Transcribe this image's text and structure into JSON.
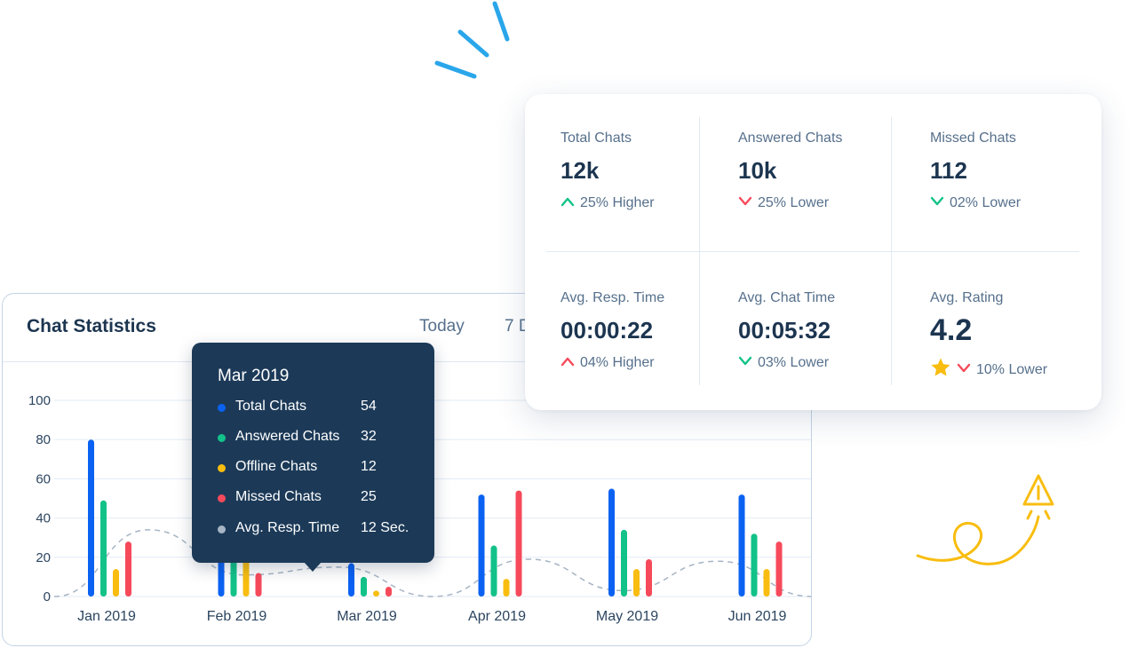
{
  "chart_panel": {
    "title": "Chat Statistics",
    "ranges": [
      "Today",
      "7 D"
    ]
  },
  "chart_data": {
    "type": "bar",
    "categories": [
      "Jan 2019",
      "Feb 2019",
      "Mar 2019",
      "Apr 2019",
      "May 2019",
      "Jun 2019"
    ],
    "series": [
      {
        "name": "Total Chats",
        "color": "#0b62f2",
        "values": [
          80,
          57,
          17,
          52,
          55,
          52
        ]
      },
      {
        "name": "Answered Chats",
        "color": "#12c289",
        "values": [
          49,
          30,
          10,
          26,
          34,
          32
        ]
      },
      {
        "name": "Offline Chats",
        "color": "#f8bd10",
        "values": [
          14,
          24,
          3,
          9,
          14,
          14
        ]
      },
      {
        "name": "Missed Chats",
        "color": "#f64a5b",
        "values": [
          28,
          12,
          5,
          54,
          19,
          28
        ]
      }
    ],
    "trend_line": {
      "name": "Avg. Resp. Time",
      "color": "#a6b4c4",
      "values": [
        0,
        34,
        11,
        15,
        0,
        19,
        3,
        18,
        0
      ]
    },
    "yticks": [
      0,
      20,
      40,
      60,
      80,
      100
    ],
    "ylim": [
      0,
      100
    ],
    "grid": true
  },
  "tooltip": {
    "title": "Mar 2019",
    "rows": [
      {
        "label": "Total Chats",
        "value": "54",
        "color": "#0b62f2"
      },
      {
        "label": "Answered Chats",
        "value": "32",
        "color": "#12c289"
      },
      {
        "label": "Offline Chats",
        "value": "12",
        "color": "#f8bd10"
      },
      {
        "label": "Missed Chats",
        "value": "25",
        "color": "#f64a5b"
      },
      {
        "label": "Avg. Resp. Time",
        "value": "12 Sec.",
        "color": "#a6b4c4"
      }
    ]
  },
  "kpis": [
    {
      "label": "Total Chats",
      "value": "12k",
      "change": "25% Higher",
      "trend": "up",
      "trend_color": "#12c289"
    },
    {
      "label": "Answered Chats",
      "value": "10k",
      "change": "25% Lower",
      "trend": "down",
      "trend_color": "#f64a5b"
    },
    {
      "label": "Missed Chats",
      "value": "112",
      "change": "02% Lower",
      "trend": "down",
      "trend_color": "#12c289"
    },
    {
      "label": "Avg. Resp. Time",
      "value": "00:00:22",
      "change": "04% Higher",
      "trend": "up",
      "trend_color": "#f64a5b"
    },
    {
      "label": "Avg. Chat Time",
      "value": "00:05:32",
      "change": "03% Lower",
      "trend": "down",
      "trend_color": "#12c289"
    },
    {
      "label": "Avg. Rating",
      "value": "4.2",
      "change": "10% Lower",
      "trend": "down",
      "trend_color": "#f64a5b",
      "icon": "star-icon",
      "icon_color": "#f8bd10"
    }
  ],
  "decor": {
    "spark_color": "#2aa6ea",
    "plane_color": "#f8bd10"
  }
}
